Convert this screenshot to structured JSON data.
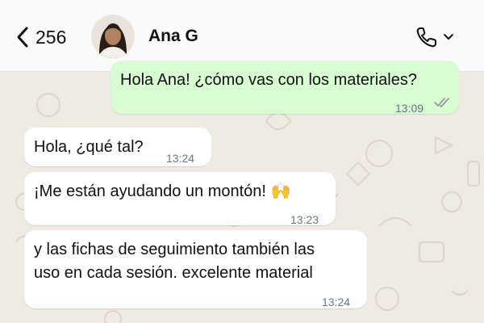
{
  "header": {
    "back_count": "256",
    "contact_name": "Ana G"
  },
  "messages": [
    {
      "direction": "outgoing",
      "lines": [
        "Hola Ana! ¿cómo vas con los materiales?"
      ],
      "time": "13:09",
      "status": "read"
    },
    {
      "direction": "incoming",
      "lines": [
        "Hola, ¿qué tal?"
      ],
      "time": "13:24"
    },
    {
      "direction": "incoming",
      "lines": [
        "¡Me están ayudando un montón! 🙌"
      ],
      "time": "13:23"
    },
    {
      "direction": "incoming",
      "lines": [
        "y las fichas de seguimiento también las",
        "uso en cada sesión. excelente material"
      ],
      "time": "13:24"
    }
  ],
  "icons": {
    "back": "chevron-left-icon",
    "call": "phone-icon",
    "call_menu": "chevron-down-icon",
    "read_status": "double-check-icon",
    "emoji": "raising-hands-emoji"
  },
  "colors": {
    "chat_background": "#efeae2",
    "outgoing_bubble": "#d9fdd3",
    "incoming_bubble": "#ffffff",
    "read_ticks": "#8a9499"
  }
}
